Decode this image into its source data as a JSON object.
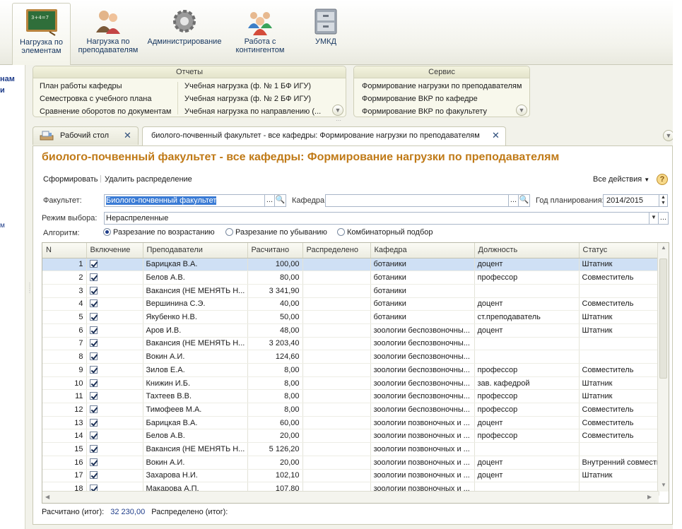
{
  "toolbar": {
    "items": [
      {
        "label1": "Нагрузка по",
        "label2": "элементам"
      },
      {
        "label1": "Нагрузка по",
        "label2": "преподавателям"
      },
      {
        "label1": "Администрирование",
        "label2": ""
      },
      {
        "label1": "Работа с",
        "label2": "контингентом"
      },
      {
        "label1": "УМКД",
        "label2": ""
      }
    ],
    "board_text": "3+4=7"
  },
  "left_strip": {
    "frag1": "нам",
    "frag2": "и",
    "frag3": "м"
  },
  "reports": {
    "title": "Отчеты",
    "col1": [
      "План работы кафедры",
      "Семестровка с учебного плана",
      "Сравнение оборотов по документам"
    ],
    "col2": [
      "Учебная нагрузка (ф. № 1 БФ ИГУ)",
      "Учебная нагрузка (ф. № 2 БФ ИГУ)",
      "Учебная нагрузка по направлению (..."
    ]
  },
  "service": {
    "title": "Сервис",
    "items": [
      "Формирование нагрузки по преподавателям",
      "Формирование ВКР по кафедре",
      "Формирование ВКР по факультету"
    ]
  },
  "tabs": [
    {
      "label": "Рабочий стол"
    },
    {
      "label": "биолого-почвенный факультет - все кафедры: Формирование нагрузки по преподавателям"
    }
  ],
  "form": {
    "title": "биолого-почвенный факультет - все кафедры: Формирование нагрузки по преподавателям",
    "actions": {
      "generate": "Сформировать",
      "delete": "Удалить распределение",
      "all": "Все действия"
    },
    "faculty_label": "Факультет:",
    "faculty_value": "Биолого-почвенный факультет",
    "dept_label": "Кафедра:",
    "dept_value": "",
    "year_label": "Год планирования:",
    "year_value": "2014/2015",
    "mode_label": "Режим выбора:",
    "mode_value": "Нераспреленные",
    "algo_label": "Алгоритм:",
    "algos": [
      "Разрезание по возрастанию",
      "Разрезание по убыванию",
      "Комбинаторный подбор"
    ],
    "columns": [
      "N",
      "Включение",
      "Преподаватели",
      "Расчитано",
      "Распределено",
      "Кафедра",
      "Должность",
      "Статус"
    ],
    "rows": [
      [
        "1",
        "Барицкая В.А.",
        "100,00",
        "",
        "ботаники",
        "доцент",
        "Штатник"
      ],
      [
        "2",
        "Белов А.В.",
        "80,00",
        "",
        "ботаники",
        "профессор",
        "Совместитель"
      ],
      [
        "3",
        "Вакансия (НЕ МЕНЯТЬ Н...",
        "3 341,90",
        "",
        "ботаники",
        "",
        ""
      ],
      [
        "4",
        "Вершинина С.Э.",
        "40,00",
        "",
        "ботаники",
        "доцент",
        "Совместитель"
      ],
      [
        "5",
        "Якубенко Н.В.",
        "50,00",
        "",
        "ботаники",
        "ст.преподаватель",
        "Штатник"
      ],
      [
        "6",
        "Аров И.В.",
        "48,00",
        "",
        "зоологии беспозвоночны...",
        "доцент",
        "Штатник"
      ],
      [
        "7",
        "Вакансия (НЕ МЕНЯТЬ Н...",
        "3 203,40",
        "",
        "зоологии беспозвоночны...",
        "",
        ""
      ],
      [
        "8",
        "Вокин А.И.",
        "124,60",
        "",
        "зоологии беспозвоночны...",
        "",
        ""
      ],
      [
        "9",
        "Зилов Е.А.",
        "8,00",
        "",
        "зоологии беспозвоночны...",
        "профессор",
        "Совместитель"
      ],
      [
        "10",
        "Книжин И.Б.",
        "8,00",
        "",
        "зоологии беспозвоночны...",
        "зав. кафедрой",
        "Штатник"
      ],
      [
        "11",
        "Тахтеев В.В.",
        "8,00",
        "",
        "зоологии беспозвоночны...",
        "профессор",
        "Штатник"
      ],
      [
        "12",
        "Тимофеев М.А.",
        "8,00",
        "",
        "зоологии беспозвоночны...",
        "профессор",
        "Совместитель"
      ],
      [
        "13",
        "Барицкая В.А.",
        "60,00",
        "",
        "зоологии позвоночных и ...",
        "доцент",
        "Совместитель"
      ],
      [
        "14",
        "Белов А.В.",
        "20,00",
        "",
        "зоологии позвоночных и ...",
        "профессор",
        "Совместитель"
      ],
      [
        "15",
        "Вакансия (НЕ МЕНЯТЬ Н...",
        "5 126,20",
        "",
        "зоологии позвоночных и ...",
        "",
        ""
      ],
      [
        "16",
        "Вокин А.И.",
        "20,00",
        "",
        "зоологии позвоночных и ...",
        "доцент",
        "Внутренний совмести"
      ],
      [
        "17",
        "Захарова Н.И.",
        "102,10",
        "",
        "зоологии позвоночных и ...",
        "доцент",
        "Штатник"
      ],
      [
        "18",
        "Макарова А.П.",
        "107,80",
        "",
        "зоологии позвоночных и ...",
        "",
        ""
      ]
    ],
    "footer": {
      "calc_label": "Расчитано (итог):",
      "calc_value": "32 230,00",
      "dist_label": "Распределено (итог):"
    }
  },
  "colors": {
    "title": "#c07a17",
    "accent": "#1f3d8a",
    "selected_row": "#cfe0f5"
  }
}
